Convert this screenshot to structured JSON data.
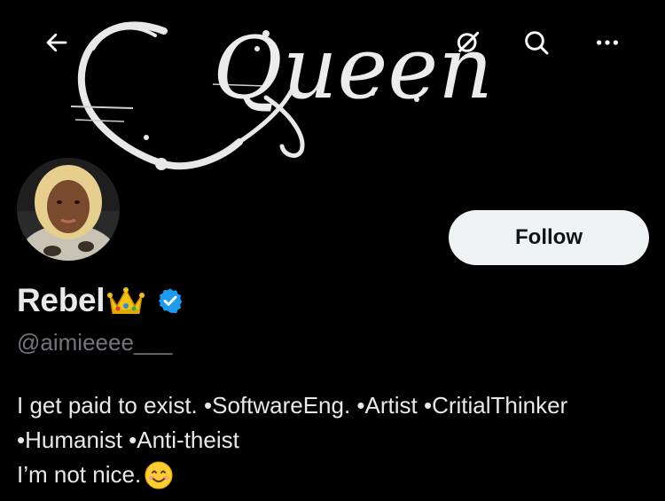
{
  "banner": {
    "text": "Queen"
  },
  "topbar": {
    "back_icon": "arrow-left-icon",
    "grok_icon": "grok-icon",
    "search_icon": "search-icon",
    "more_icon": "more-horizontal-icon"
  },
  "profile": {
    "display_name": "Rebel",
    "name_emoji": "crown-emoji",
    "verified": true,
    "verified_color": "#1d9bf0",
    "handle": "@aimieeee___",
    "follow_label": "Follow",
    "bio_lines": [
      "I get paid to exist. •SoftwareEng. •Artist •CritialThinker",
      "•Humanist •Anti-theist",
      "I’m not nice."
    ],
    "bio_emoji": "smiling-face-emoji"
  },
  "colors": {
    "background": "#000000",
    "text": "#e7e9ea",
    "secondary": "#71767b",
    "accent": "#1d9bf0"
  }
}
